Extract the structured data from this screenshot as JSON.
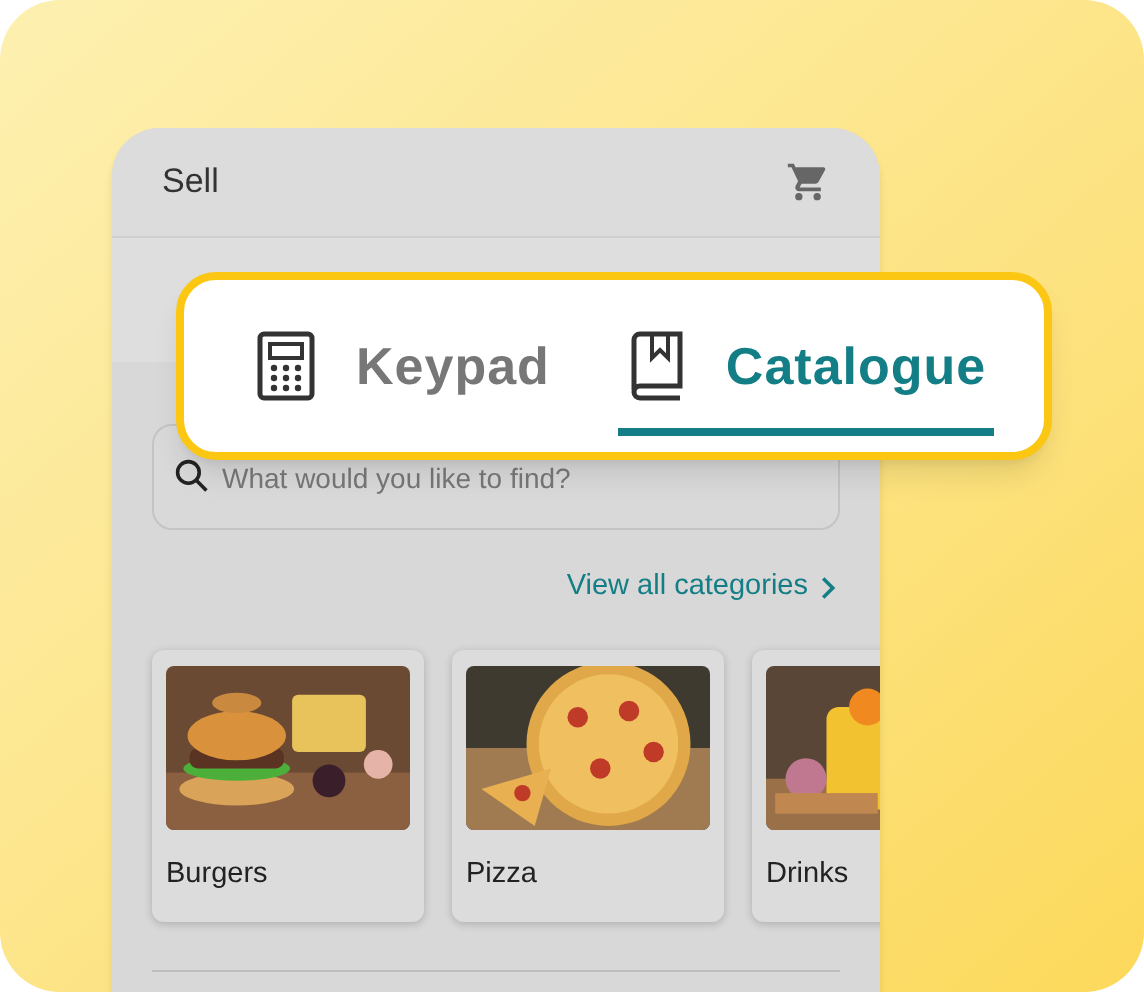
{
  "header": {
    "title": "Sell"
  },
  "tabs": [
    {
      "label": "Keypad",
      "kind": "keypad",
      "selected": false
    },
    {
      "label": "Catalogue",
      "kind": "catalogue",
      "selected": true
    }
  ],
  "search": {
    "placeholder": "What would you like to find?"
  },
  "categories_link": {
    "label": "View all categories"
  },
  "categories": [
    {
      "name": "Burgers",
      "kind": "picture"
    },
    {
      "name": "Pizza",
      "kind": "picture"
    },
    {
      "name": "Drinks",
      "kind": "picture"
    }
  ]
}
